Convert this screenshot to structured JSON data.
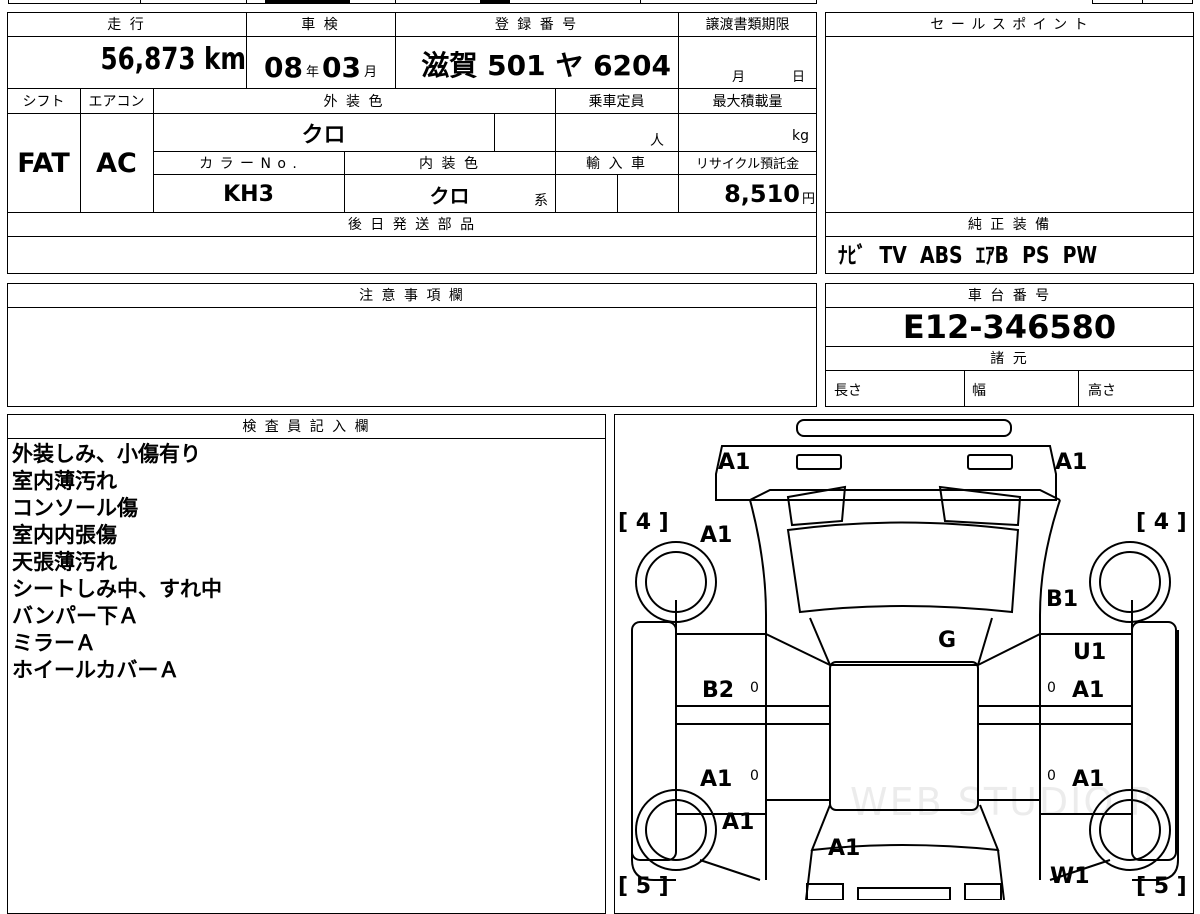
{
  "header_row": {
    "mileage_label": "走 行",
    "shaken_label": "車 検",
    "registration_label": "登 録 番 号",
    "transfer_deadline_label": "譲渡書類期限",
    "sales_point_label": "セ ー ル ス ポ イ ン ト"
  },
  "values_row": {
    "mileage": "56,873 km",
    "shaken_year": "08",
    "shaken_year_unit": "年",
    "shaken_month": "03",
    "shaken_month_unit": "月",
    "registration": "滋賀 501 ヤ 6204",
    "deadline_month_unit": "月",
    "deadline_day_unit": "日"
  },
  "spec_row": {
    "shift_label": "シフト",
    "aircon_label": "エアコン",
    "exterior_color_label": "外 装 色",
    "capacity_label": "乗車定員",
    "max_load_label": "最大積載量",
    "shift": "FAT",
    "aircon": "AC",
    "exterior_color": "クロ",
    "capacity_unit": "人",
    "max_load_unit": "kg",
    "color_no_label": "カ ラ ー N o .",
    "interior_color_label": "内 装 色",
    "import_label": "輸 入 車",
    "recycle_label": "リサイクル預託金",
    "color_no": "KH3",
    "interior_color": "クロ",
    "interior_color_suffix": "系",
    "recycle_fee": "8,510",
    "recycle_unit": "円"
  },
  "later_parts": {
    "label": "後 日 発 送 部 品"
  },
  "genuine_equipment": {
    "label": "純 正 装 備",
    "value": "ﾅﾋﾞ  TV  ABS  ｴｱB  PS  PW"
  },
  "caution": {
    "label": "注 意 事 項 欄"
  },
  "chassis": {
    "label": "車 台 番 号",
    "value": "E12-346580",
    "specs_label": "諸 元",
    "length_label": "長さ",
    "width_label": "幅",
    "height_label": "高さ"
  },
  "inspector": {
    "label": "検 査 員 記 入 欄",
    "notes": [
      "外装しみ、小傷有り",
      "室内薄汚れ",
      "コンソール傷",
      "室内内張傷",
      "天張薄汚れ",
      "シートしみ中、すれ中",
      "バンパー下Ａ",
      "ミラーＡ",
      "ホイールカバーＡ"
    ]
  },
  "diagram": {
    "tire_front_left": "[ 4 ]",
    "tire_front_right": "[ 4 ]",
    "tire_rear_left": "[ 5 ]",
    "tire_rear_right": "[ 5 ]",
    "marks": {
      "front_bumper_left": "A1",
      "front_bumper_right": "A1",
      "front_left_fender": "A1",
      "front_right_fender": "B1",
      "windshield": "G",
      "right_front_door_top": "U1",
      "left_front_door": "B2",
      "right_front_door": "A1",
      "left_rear_door": "A1",
      "right_rear_door": "A1",
      "left_rear_fender": "A1",
      "rear_hatch": "A1",
      "right_rear_fender": "W1"
    },
    "small_zero": "0",
    "watermark": "WEB STUDIO PRO"
  }
}
